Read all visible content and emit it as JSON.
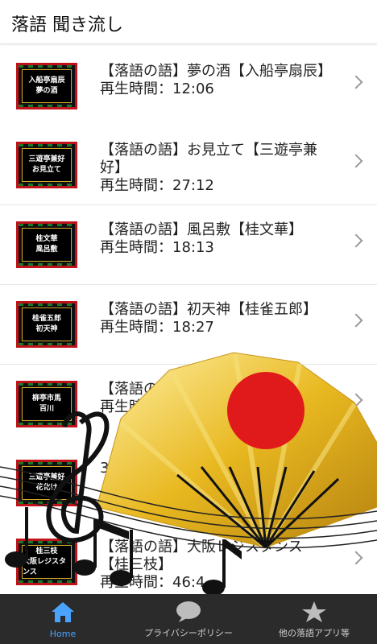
{
  "app": {
    "title": "落語 聞き流し"
  },
  "items": [
    {
      "title": "【落語の語】夢の酒【入船亭扇辰】",
      "duration": "再生時間：12:06",
      "thumb": [
        "入船亭扇辰",
        "夢の酒"
      ]
    },
    {
      "title": "【落語の語】お見立て【三遊亭兼好】",
      "duration": "再生時間：27:12",
      "thumb": [
        "三遊亭兼好",
        "お見立て"
      ]
    },
    {
      "title": "【落語の語】風呂敷【桂文華】",
      "duration": "再生時間：18:13",
      "thumb": [
        "桂文華",
        "風呂敷"
      ]
    },
    {
      "title": "【落語の語】初天神【桂雀五郎】",
      "duration": "再生時間：18:27",
      "thumb": [
        "桂雀五郎",
        "初天神"
      ]
    },
    {
      "title": "【落語の",
      "duration": "再生時",
      "thumb": [
        "柳亭市馬",
        "百川"
      ]
    },
    {
      "title": "",
      "duration": "37",
      "thumb": [
        "三遊亭兼好",
        "花化け"
      ]
    },
    {
      "title": "【落語の語】大阪レジスタンス【桂三枝】",
      "duration": "再生時間：46:4",
      "thumb": [
        "桂三枝",
        "大阪レジスタンス"
      ]
    }
  ],
  "nav": [
    {
      "label": "Home",
      "icon": "home-icon",
      "active": true
    },
    {
      "label": "プライバシーポリシー",
      "icon": "speech-bubble-icon",
      "active": false
    },
    {
      "label": "他の落語アプリ等",
      "icon": "star-icon",
      "active": false
    }
  ],
  "colors": {
    "nav_bg": "#2b2b2b",
    "active": "#4aa3ff",
    "thumb_border": "#c0121a"
  }
}
